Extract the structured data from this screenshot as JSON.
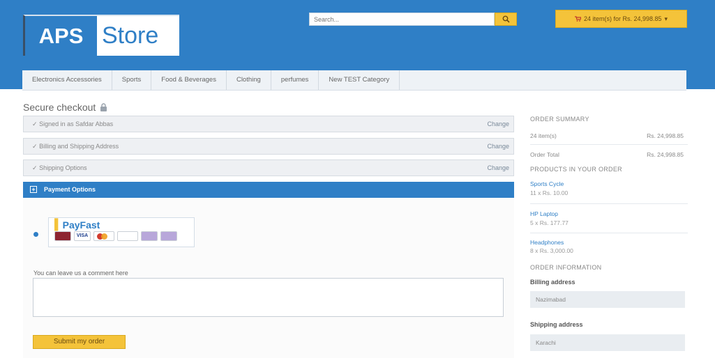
{
  "header": {
    "logo_left": "APS",
    "logo_right": "Store",
    "search_placeholder": "Search...",
    "cart_label": "24 item(s) for Rs. 24,998.85",
    "accent_blue": "#2f7fc6",
    "accent_yellow": "#f4c33a"
  },
  "nav": {
    "items": [
      {
        "label": "Electronics Accessories"
      },
      {
        "label": "Sports"
      },
      {
        "label": "Food & Beverages"
      },
      {
        "label": "Clothing"
      },
      {
        "label": "perfumes"
      },
      {
        "label": "New TEST Category"
      }
    ]
  },
  "checkout": {
    "title": "Secure checkout",
    "steps": [
      {
        "label": "Signed in as Safdar Abbas",
        "change": "Change"
      },
      {
        "label": "Billing and Shipping Address",
        "change": "Change"
      },
      {
        "label": "Shipping Options",
        "change": "Change"
      }
    ],
    "payment_title": "Payment Options",
    "payfast_logo": "PayFast",
    "card_visa": "VISA",
    "comment_label": "You can leave us a comment here",
    "submit_label": "Submit my order"
  },
  "summary": {
    "heading": "ORDER SUMMARY",
    "items_label": "24 item(s)",
    "items_value": "Rs. 24,998.85",
    "total_label": "Order Total",
    "total_value": "Rs. 24,998.85",
    "products_heading": "PRODUCTS IN YOUR ORDER",
    "products": [
      {
        "name": "Sports Cycle",
        "qty": "11 x Rs. 10.00"
      },
      {
        "name": "HP Laptop",
        "qty": "5 x Rs. 177.77"
      },
      {
        "name": "Headphones",
        "qty": "8 x Rs. 3,000.00"
      }
    ],
    "info_heading": "ORDER INFORMATION",
    "billing_label": "Billing address",
    "billing_value": "Nazimabad",
    "shipping_label": "Shipping address",
    "shipping_value": "Karachi"
  }
}
